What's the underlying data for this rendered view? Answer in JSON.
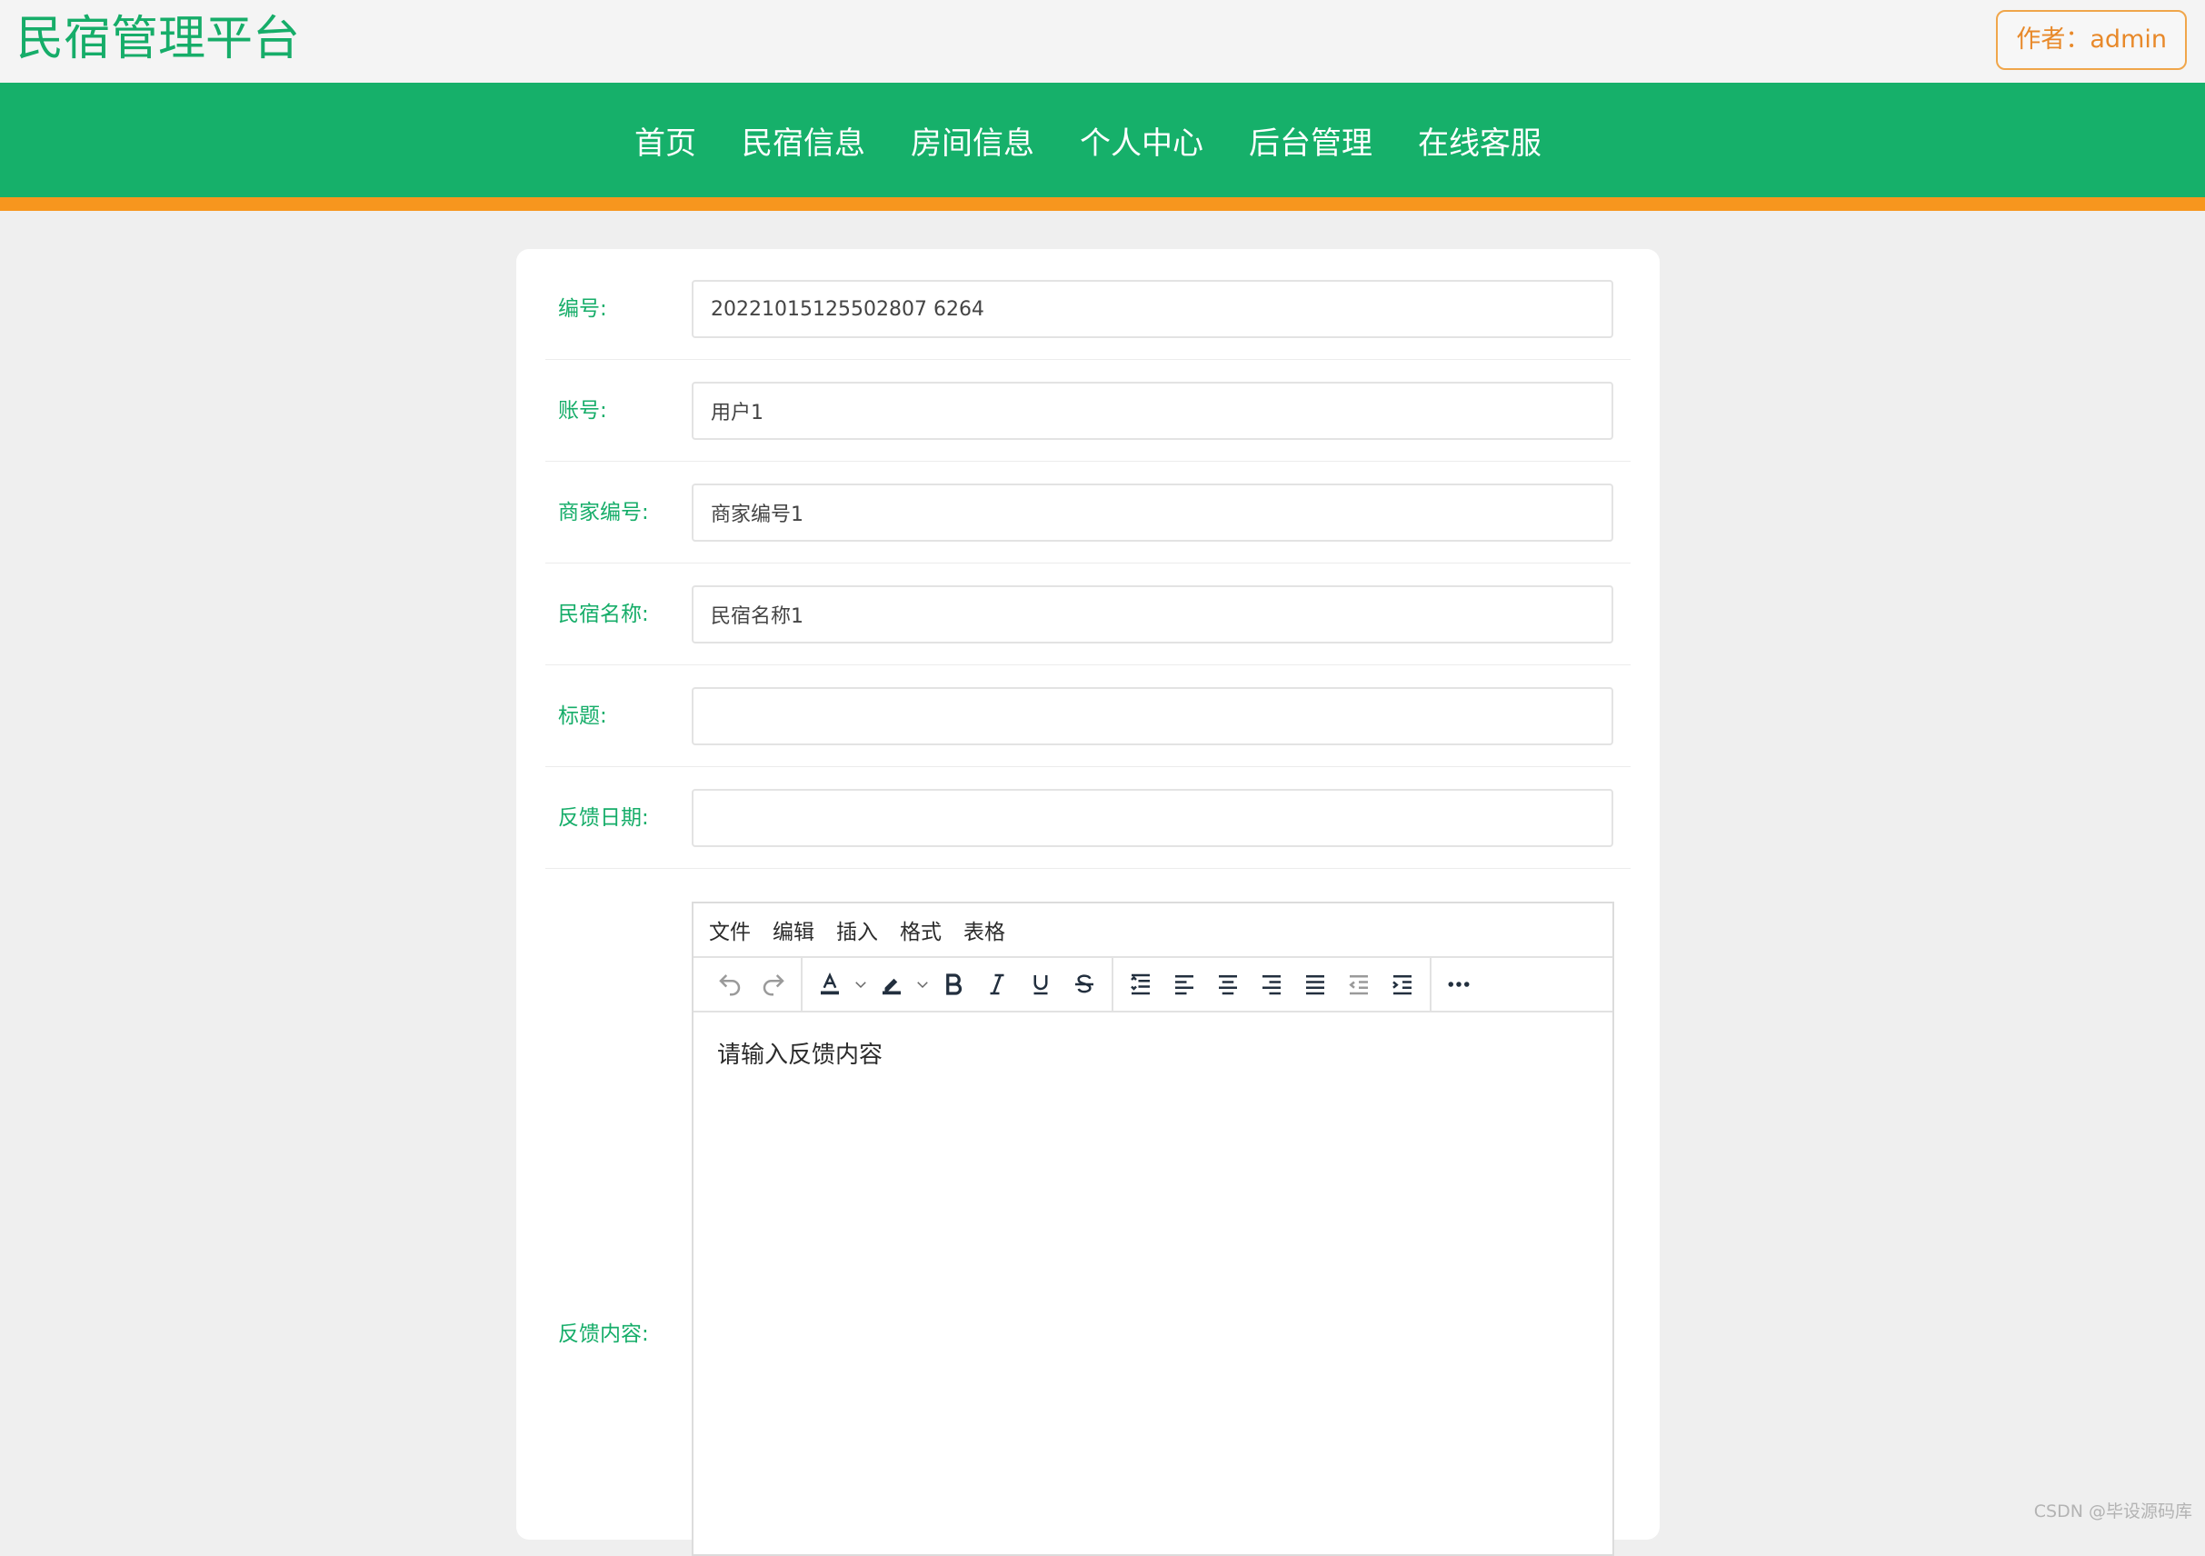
{
  "header": {
    "brand": "民宿管理平台",
    "author_label": "作者：admin"
  },
  "nav": {
    "items": [
      "首页",
      "民宿信息",
      "房间信息",
      "个人中心",
      "后台管理",
      "在线客服"
    ]
  },
  "form": {
    "fields": [
      {
        "label": "编号:",
        "value": "20221015125502807 6264"
      },
      {
        "label": "账号:",
        "value": "用户1"
      },
      {
        "label": "商家编号:",
        "value": "商家编号1"
      },
      {
        "label": "民宿名称:",
        "value": "民宿名称1"
      },
      {
        "label": "标题:",
        "value": ""
      },
      {
        "label": "反馈日期:",
        "value": ""
      }
    ],
    "content_label": "反馈内容:",
    "editor": {
      "menus": [
        "文件",
        "编辑",
        "插入",
        "格式",
        "表格"
      ],
      "placeholder": "请输入反馈内容"
    }
  },
  "watermark": "CSDN @毕设源码库",
  "colors": {
    "brand_green": "#16ad69",
    "nav_green": "#16b06a",
    "accent_orange": "#f7961e",
    "author_orange": "#e8892a"
  }
}
